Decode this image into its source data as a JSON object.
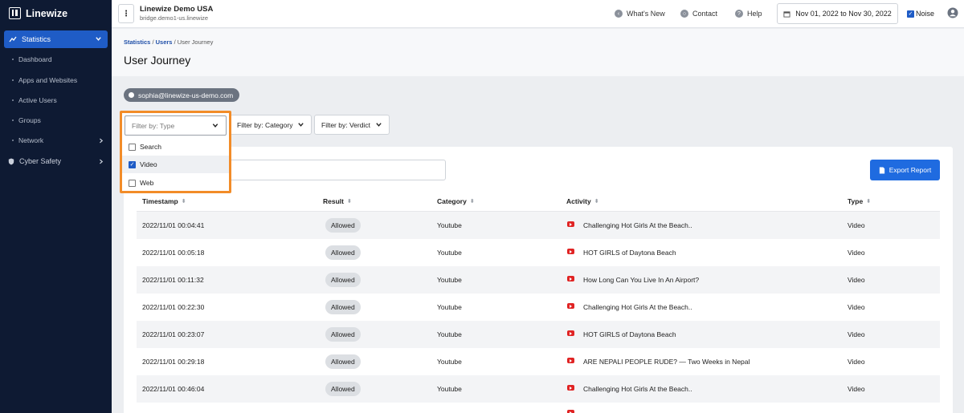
{
  "app": {
    "name": "Linewize"
  },
  "sidebar": {
    "statistics": "Statistics",
    "items": [
      "Dashboard",
      "Apps and Websites",
      "Active Users",
      "Groups"
    ],
    "network": "Network",
    "cyber_safety": "Cyber Safety"
  },
  "topbar": {
    "org_name": "Linewize Demo USA",
    "org_sub": "bridge.demo1-us.linewize",
    "whats_new": "What's New",
    "contact": "Contact",
    "help": "Help",
    "date_range": "Nov 01, 2022 to Nov 30, 2022",
    "noise": "Noise"
  },
  "breadcrumb": {
    "statistics": "Statistics",
    "users": "Users",
    "current": "User Journey"
  },
  "page_title": "User Journey",
  "user_chip": "sophia@linewize-us-demo.com",
  "filters": {
    "type_placeholder": "Filter by: Type",
    "category": "Filter by: Category",
    "verdict": "Filter by: Verdict",
    "type_options": [
      {
        "label": "Search",
        "checked": false
      },
      {
        "label": "Video",
        "checked": true
      },
      {
        "label": "Web",
        "checked": false
      }
    ]
  },
  "export_label": "Export Report",
  "table": {
    "headers": [
      "Timestamp",
      "Result",
      "Category",
      "Activity",
      "Type"
    ],
    "rows": [
      [
        "2022/11/01 00:04:41",
        "Allowed",
        "Youtube",
        "Challenging Hot Girls At the Beach..",
        "Video"
      ],
      [
        "2022/11/01 00:05:18",
        "Allowed",
        "Youtube",
        "HOT GIRLS of Daytona Beach",
        "Video"
      ],
      [
        "2022/11/01 00:11:32",
        "Allowed",
        "Youtube",
        "How Long Can You Live In An Airport?",
        "Video"
      ],
      [
        "2022/11/01 00:22:30",
        "Allowed",
        "Youtube",
        "Challenging Hot Girls At the Beach..",
        "Video"
      ],
      [
        "2022/11/01 00:23:07",
        "Allowed",
        "Youtube",
        "HOT GIRLS of Daytona Beach",
        "Video"
      ],
      [
        "2022/11/01 00:29:18",
        "Allowed",
        "Youtube",
        "ARE NEPALI PEOPLE RUDE? — Two Weeks in Nepal",
        "Video"
      ],
      [
        "2022/11/01 00:46:04",
        "Allowed",
        "Youtube",
        "Challenging Hot Girls At the Beach..",
        "Video"
      ]
    ]
  },
  "colors": {
    "sidebar": "#0e1a33",
    "accent": "#1f5cc6",
    "highlight": "#f28c28",
    "youtube": "#e02424"
  }
}
